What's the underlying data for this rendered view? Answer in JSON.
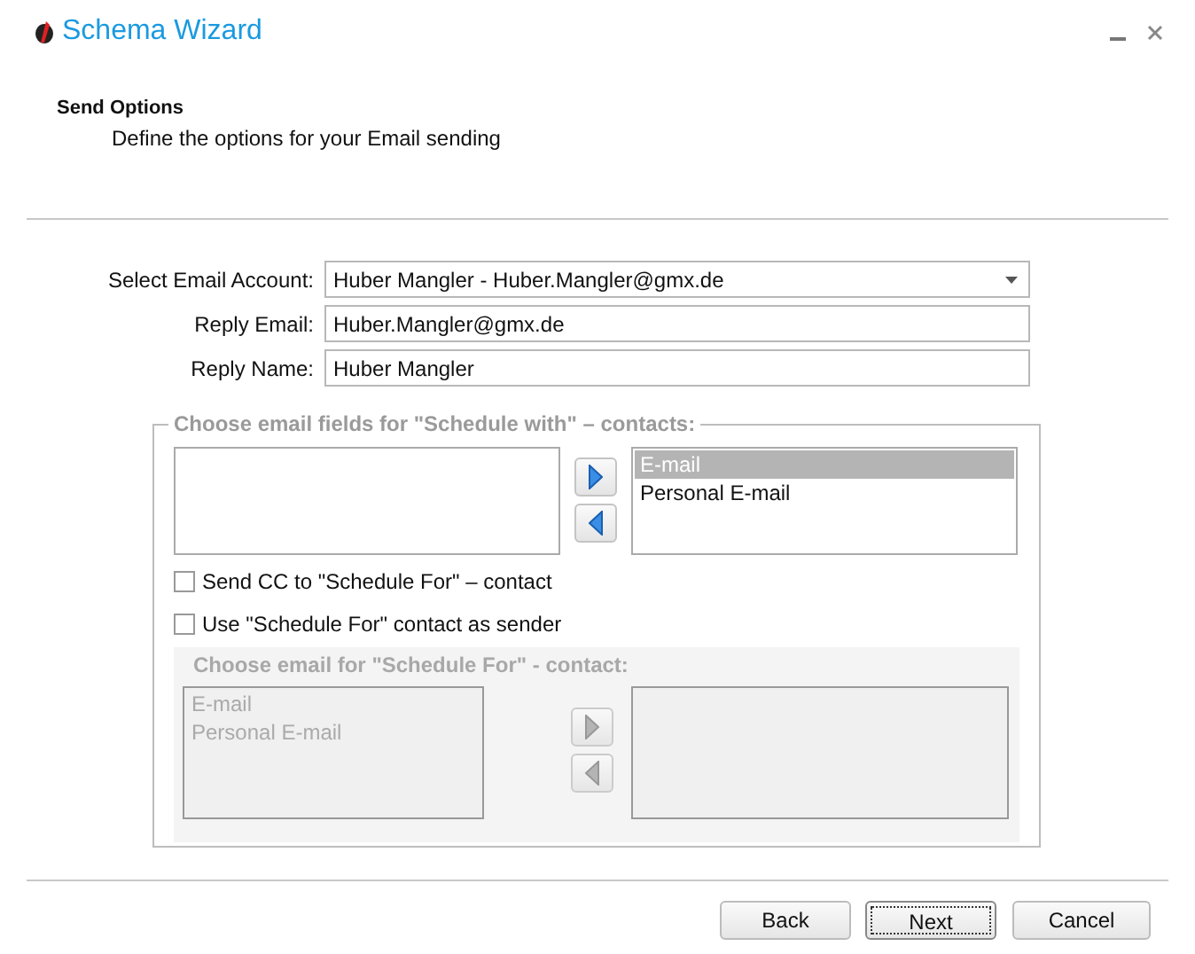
{
  "window": {
    "title": "Schema Wizard"
  },
  "header": {
    "title": "Send Options",
    "subtitle": "Define the options for your Email sending"
  },
  "fields": [
    {
      "label": "Select Email Account:",
      "value": "Huber Mangler - Huber.Mangler@gmx.de",
      "kind": "dropdown"
    },
    {
      "label": "Reply Email:",
      "value": "Huber.Mangler@gmx.de",
      "kind": "text"
    },
    {
      "label": "Reply Name:",
      "value": "Huber Mangler",
      "kind": "text"
    }
  ],
  "schedule_with_group": {
    "legend": "Choose email fields for \"Schedule with\" – contacts:",
    "disabled": false,
    "chosen": [
      {
        "text": "E-mail",
        "selected": true
      },
      {
        "text": "Personal E-mail",
        "selected": false
      }
    ]
  },
  "checkboxes": [
    {
      "label": "Send CC to \"Schedule For\" – contact",
      "checked": false
    },
    {
      "label": "Use \"Schedule For\" contact as sender",
      "checked": false
    }
  ],
  "schedule_for_group": {
    "legend": "Choose email for \"Schedule For\" - contact:",
    "disabled": true,
    "available": [
      {
        "text": "E-mail",
        "selected": false
      },
      {
        "text": "Personal E-mail",
        "selected": false
      }
    ]
  },
  "buttons": [
    {
      "label": "Back",
      "focused": false
    },
    {
      "label": "Next",
      "focused": true
    },
    {
      "label": "Cancel",
      "focused": false
    }
  ]
}
